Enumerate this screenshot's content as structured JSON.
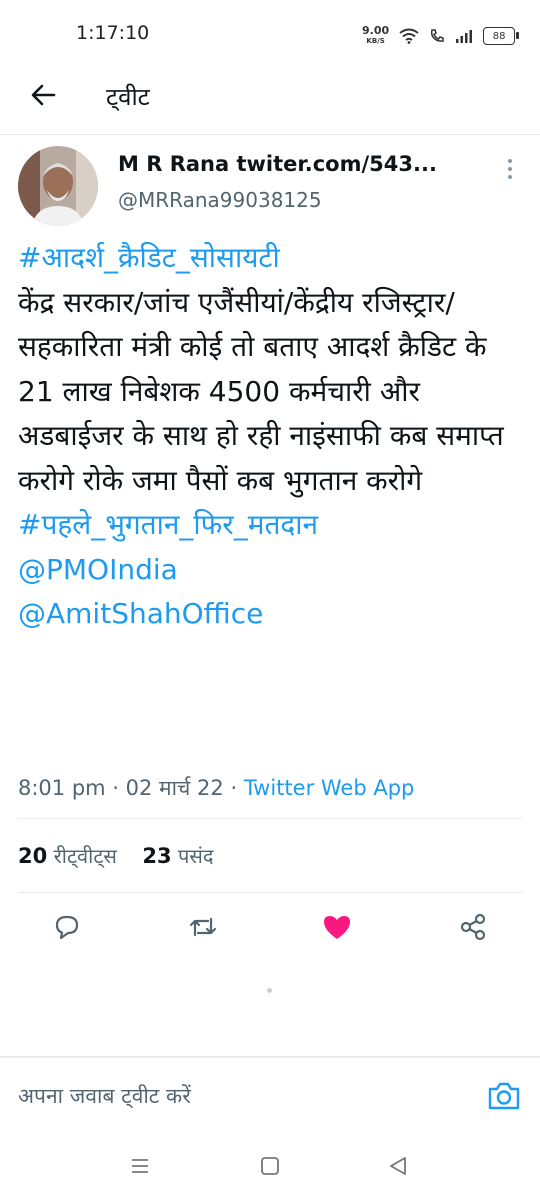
{
  "status": {
    "time": "1:17:10",
    "net_speed": "9.00",
    "net_unit": "KB/S",
    "battery": "88"
  },
  "header": {
    "title": "ट्वीट"
  },
  "tweet": {
    "author_name": "M R Rana twiter.com/543...",
    "handle": "@MRRana99038125",
    "hashtag_top": "#आदर्श_क्रैडिट_सोसायटी",
    "body": "केंद्र सरकार/जांच एजैंसीयां/केंद्रीय रजिस्ट्रार/सहकारिता मंत्री कोई तो बताए आदर्श क्रैडिट के 21 लाख निबेशक 4500 कर्मचारी और अडबाईजर के साथ हो रही नाइंसाफी कब समाप्त करोगे रोके जमा पैसों कब भुगतान करोगे",
    "hashtag_bottom": "#पहले_भुगतान_फिर_मतदान",
    "mention_1": "@PMOIndia",
    "mention_2": "@AmitShahOffice",
    "time": "8:01 pm",
    "date": "02 मार्च 22",
    "source": "Twitter Web App",
    "separator": " · "
  },
  "stats": {
    "retweets_count": "20",
    "retweets_label": "रीट्वीट्स",
    "likes_count": "23",
    "likes_label": "पसंद"
  },
  "reply": {
    "placeholder": "अपना जवाब ट्वीट करें"
  },
  "colors": {
    "link": "#1d9bf0",
    "like": "#f91880",
    "secondary": "#536471"
  }
}
